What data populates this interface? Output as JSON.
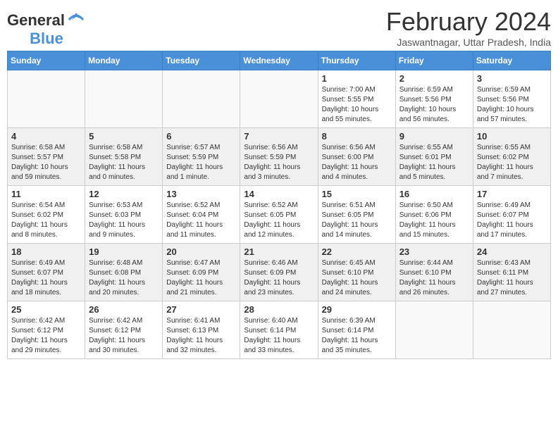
{
  "header": {
    "logo_general": "General",
    "logo_blue": "Blue",
    "title": "February 2024",
    "location": "Jaswantnagar, Uttar Pradesh, India"
  },
  "days_of_week": [
    "Sunday",
    "Monday",
    "Tuesday",
    "Wednesday",
    "Thursday",
    "Friday",
    "Saturday"
  ],
  "weeks": [
    {
      "days": [
        {
          "num": "",
          "info": ""
        },
        {
          "num": "",
          "info": ""
        },
        {
          "num": "",
          "info": ""
        },
        {
          "num": "",
          "info": ""
        },
        {
          "num": "1",
          "info": "Sunrise: 7:00 AM\nSunset: 5:55 PM\nDaylight: 10 hours\nand 55 minutes."
        },
        {
          "num": "2",
          "info": "Sunrise: 6:59 AM\nSunset: 5:56 PM\nDaylight: 10 hours\nand 56 minutes."
        },
        {
          "num": "3",
          "info": "Sunrise: 6:59 AM\nSunset: 5:56 PM\nDaylight: 10 hours\nand 57 minutes."
        }
      ]
    },
    {
      "days": [
        {
          "num": "4",
          "info": "Sunrise: 6:58 AM\nSunset: 5:57 PM\nDaylight: 10 hours\nand 59 minutes."
        },
        {
          "num": "5",
          "info": "Sunrise: 6:58 AM\nSunset: 5:58 PM\nDaylight: 11 hours\nand 0 minutes."
        },
        {
          "num": "6",
          "info": "Sunrise: 6:57 AM\nSunset: 5:59 PM\nDaylight: 11 hours\nand 1 minute."
        },
        {
          "num": "7",
          "info": "Sunrise: 6:56 AM\nSunset: 5:59 PM\nDaylight: 11 hours\nand 3 minutes."
        },
        {
          "num": "8",
          "info": "Sunrise: 6:56 AM\nSunset: 6:00 PM\nDaylight: 11 hours\nand 4 minutes."
        },
        {
          "num": "9",
          "info": "Sunrise: 6:55 AM\nSunset: 6:01 PM\nDaylight: 11 hours\nand 5 minutes."
        },
        {
          "num": "10",
          "info": "Sunrise: 6:55 AM\nSunset: 6:02 PM\nDaylight: 11 hours\nand 7 minutes."
        }
      ]
    },
    {
      "days": [
        {
          "num": "11",
          "info": "Sunrise: 6:54 AM\nSunset: 6:02 PM\nDaylight: 11 hours\nand 8 minutes."
        },
        {
          "num": "12",
          "info": "Sunrise: 6:53 AM\nSunset: 6:03 PM\nDaylight: 11 hours\nand 9 minutes."
        },
        {
          "num": "13",
          "info": "Sunrise: 6:52 AM\nSunset: 6:04 PM\nDaylight: 11 hours\nand 11 minutes."
        },
        {
          "num": "14",
          "info": "Sunrise: 6:52 AM\nSunset: 6:05 PM\nDaylight: 11 hours\nand 12 minutes."
        },
        {
          "num": "15",
          "info": "Sunrise: 6:51 AM\nSunset: 6:05 PM\nDaylight: 11 hours\nand 14 minutes."
        },
        {
          "num": "16",
          "info": "Sunrise: 6:50 AM\nSunset: 6:06 PM\nDaylight: 11 hours\nand 15 minutes."
        },
        {
          "num": "17",
          "info": "Sunrise: 6:49 AM\nSunset: 6:07 PM\nDaylight: 11 hours\nand 17 minutes."
        }
      ]
    },
    {
      "days": [
        {
          "num": "18",
          "info": "Sunrise: 6:49 AM\nSunset: 6:07 PM\nDaylight: 11 hours\nand 18 minutes."
        },
        {
          "num": "19",
          "info": "Sunrise: 6:48 AM\nSunset: 6:08 PM\nDaylight: 11 hours\nand 20 minutes."
        },
        {
          "num": "20",
          "info": "Sunrise: 6:47 AM\nSunset: 6:09 PM\nDaylight: 11 hours\nand 21 minutes."
        },
        {
          "num": "21",
          "info": "Sunrise: 6:46 AM\nSunset: 6:09 PM\nDaylight: 11 hours\nand 23 minutes."
        },
        {
          "num": "22",
          "info": "Sunrise: 6:45 AM\nSunset: 6:10 PM\nDaylight: 11 hours\nand 24 minutes."
        },
        {
          "num": "23",
          "info": "Sunrise: 6:44 AM\nSunset: 6:10 PM\nDaylight: 11 hours\nand 26 minutes."
        },
        {
          "num": "24",
          "info": "Sunrise: 6:43 AM\nSunset: 6:11 PM\nDaylight: 11 hours\nand 27 minutes."
        }
      ]
    },
    {
      "days": [
        {
          "num": "25",
          "info": "Sunrise: 6:42 AM\nSunset: 6:12 PM\nDaylight: 11 hours\nand 29 minutes."
        },
        {
          "num": "26",
          "info": "Sunrise: 6:42 AM\nSunset: 6:12 PM\nDaylight: 11 hours\nand 30 minutes."
        },
        {
          "num": "27",
          "info": "Sunrise: 6:41 AM\nSunset: 6:13 PM\nDaylight: 11 hours\nand 32 minutes."
        },
        {
          "num": "28",
          "info": "Sunrise: 6:40 AM\nSunset: 6:14 PM\nDaylight: 11 hours\nand 33 minutes."
        },
        {
          "num": "29",
          "info": "Sunrise: 6:39 AM\nSunset: 6:14 PM\nDaylight: 11 hours\nand 35 minutes."
        },
        {
          "num": "",
          "info": ""
        },
        {
          "num": "",
          "info": ""
        }
      ]
    }
  ]
}
